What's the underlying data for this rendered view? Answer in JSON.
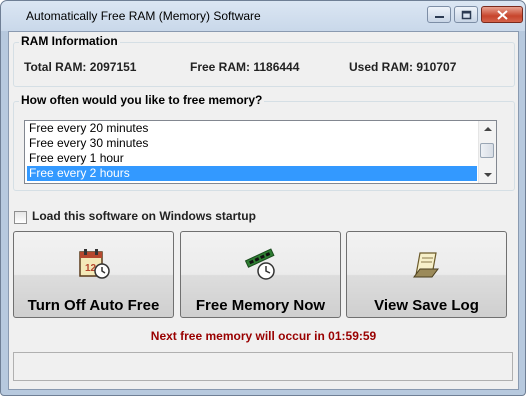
{
  "window": {
    "title": "Automatically Free RAM (Memory) Software"
  },
  "ram_info": {
    "legend": "RAM Information",
    "total": "Total RAM: 2097151",
    "free": "Free RAM: 1186444",
    "used": "Used RAM: 910707"
  },
  "frequency": {
    "legend": "How often would you like to free memory?",
    "options": [
      "Free every 20 minutes",
      "Free every 30 minutes",
      "Free every 1 hour",
      "Free every 2 hours"
    ],
    "selected": "Free every 2 hours"
  },
  "startup": {
    "label": "Load this software on Windows startup",
    "checked": false
  },
  "buttons": {
    "auto_free": "Turn Off Auto Free",
    "free_now": "Free Memory Now",
    "save_log": "View Save Log"
  },
  "next_free": "Next free memory will occur in 01:59:59",
  "status_text": "",
  "colors": {
    "selection": "#3399ff",
    "next_text": "#990000"
  }
}
